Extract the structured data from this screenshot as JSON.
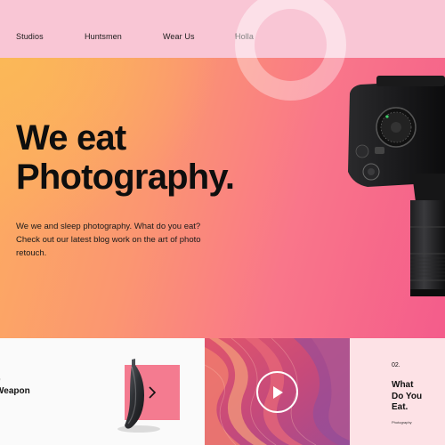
{
  "nav": {
    "items": [
      {
        "label": "Studios"
      },
      {
        "label": "Huntsmen"
      },
      {
        "label": "Wear Us"
      },
      {
        "label": "Holla"
      }
    ]
  },
  "hero": {
    "title_line1": "We eat",
    "title_line2": "Photography.",
    "description": "We we and sleep photography. What do you eat? Check out our latest blog work on the art of photo retouch."
  },
  "cards": {
    "weapon": {
      "text": "e\nWeapon\n."
    },
    "video": {
      "play_label": "play"
    },
    "blog": {
      "number": "02.",
      "title": "What\nDo You\nEat.",
      "tag": "Photography"
    }
  },
  "colors": {
    "nav_bg": "#f9c6d5",
    "hero_orange": "#fcae5f",
    "hero_pink": "#f45c8b",
    "arrow_box": "#f47b90",
    "card_blog_bg": "#fde2e6"
  }
}
